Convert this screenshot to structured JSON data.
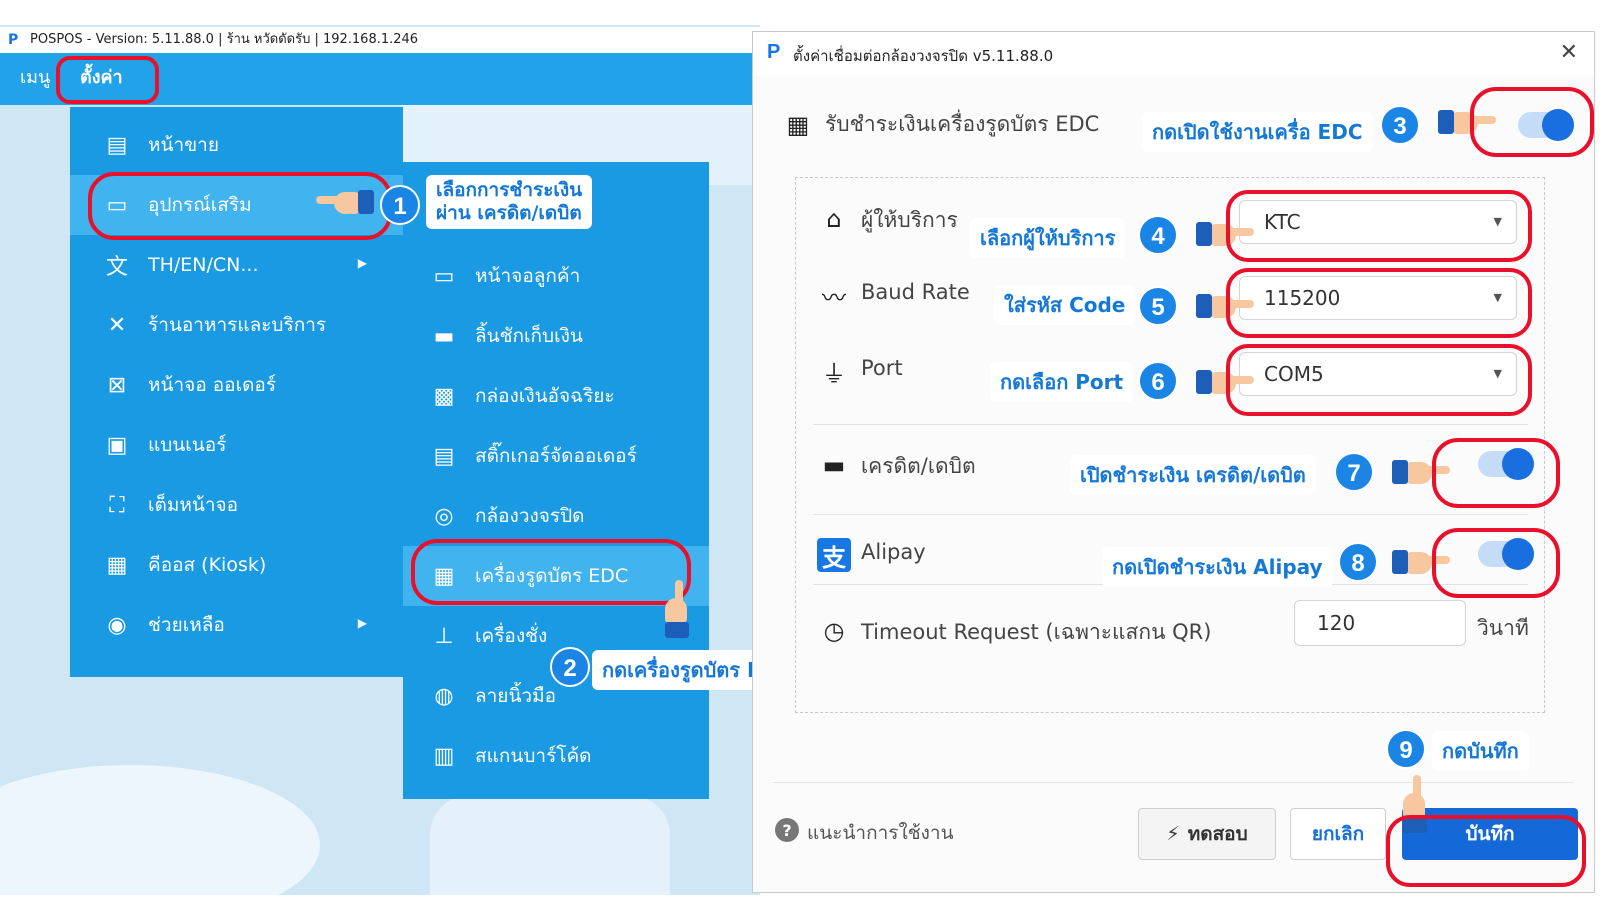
{
  "app": {
    "logo": "P",
    "title": "POSPOS - Version: 5.11.88.0  |  ร้าน หวัดดัดรับ  |  192.168.1.246",
    "menubar": {
      "menu_label": "เมนู",
      "settings_label": "ตั้งค่า"
    }
  },
  "menu_level1": [
    {
      "label": "หน้าขาย",
      "icon": "register-icon"
    },
    {
      "label": "อุปกรณ์เสริม",
      "icon": "devices-icon"
    },
    {
      "label": "TH/EN/CN...",
      "icon": "translate-icon",
      "has_submenu": true
    },
    {
      "label": "ร้านอาหารและบริการ",
      "icon": "utensils-icon"
    },
    {
      "label": "หน้าจอ ออเดอร์",
      "icon": "order-screen-icon"
    },
    {
      "label": "แบนเนอร์",
      "icon": "banner-icon"
    },
    {
      "label": "เต็มหน้าจอ",
      "icon": "fullscreen-icon"
    },
    {
      "label": "คีออส (Kiosk)",
      "icon": "kiosk-icon"
    },
    {
      "label": "ช่วยเหลือ",
      "icon": "help-icon",
      "has_submenu": true
    }
  ],
  "menu_level2": [
    {
      "label": "หน้าจอลูกค้า",
      "icon": "monitor-icon"
    },
    {
      "label": "ลิ้นชักเก็บเงิน",
      "icon": "cash-drawer-icon"
    },
    {
      "label": "กล่องเงินอัจฉริยะ",
      "icon": "smart-cashbox-icon"
    },
    {
      "label": "สติ๊กเกอร์จัดออเดอร์",
      "icon": "sticker-printer-icon"
    },
    {
      "label": "กล้องวงจรปิด",
      "icon": "cctv-icon"
    },
    {
      "label": "เครื่องรูดบัตร EDC",
      "icon": "edc-icon"
    },
    {
      "label": "เครื่องชั่ง",
      "icon": "scale-icon"
    },
    {
      "label": "ลายนิ้วมือ",
      "icon": "fingerprint-icon"
    },
    {
      "label": "สแกนบาร์โค้ด",
      "icon": "barcode-icon"
    }
  ],
  "annotations": {
    "step1": {
      "num": "1",
      "text_line1": "เลือกการชำระเงิน",
      "text_line2": "ผ่าน เครดิต/เดบิต"
    },
    "step2": {
      "num": "2",
      "text": "กดเครื่องรูดบัตร EDC"
    },
    "step3": {
      "num": "3",
      "text": "กดเปิดใช้งานเครื่อ EDC"
    },
    "step4": {
      "num": "4",
      "text": "เลือกผู้ให้บริการ"
    },
    "step5": {
      "num": "5",
      "text": "ใส่รหัส Code"
    },
    "step6": {
      "num": "6",
      "text": "กดเลือก Port"
    },
    "step7": {
      "num": "7",
      "text": "เปิดชำระเงิน เครดิต/เดบิต"
    },
    "step8": {
      "num": "8",
      "text": "กดเปิดชำระเงิน Alipay"
    },
    "step9": {
      "num": "9",
      "text": "กดบันทึก"
    }
  },
  "dialog": {
    "logo": "P",
    "title": "ตั้งค่าเชื่อมต่อกล้องวงจรปิด v5.11.88.0",
    "close_glyph": "✕",
    "edc_label": "รับชำระเงินเครื่องรูดบัตร EDC",
    "edc_enabled": true,
    "provider_label": "ผู้ให้บริการ",
    "provider_value": "KTC",
    "baud_label": "Baud Rate",
    "baud_value": "115200",
    "port_label": "Port",
    "port_value": "COM5",
    "credit_label": "เครดิต/เดบิต",
    "credit_enabled": true,
    "alipay_label": "Alipay",
    "alipay_enabled": true,
    "timeout_label": "Timeout Request (เฉพาะแสกน QR)",
    "timeout_value": "120",
    "timeout_unit": "วินาที",
    "help_glyph": "?",
    "help_label": "แนะนำการใช้งาน",
    "test_label": "ทดสอบ",
    "cancel_label": "ยกเลิก",
    "save_label": "บันทึก"
  },
  "colors": {
    "menu_blue": "#1a9ae3",
    "highlight_red": "#e8102a",
    "step_blue": "#1a85e5",
    "save_blue": "#1468d8"
  }
}
